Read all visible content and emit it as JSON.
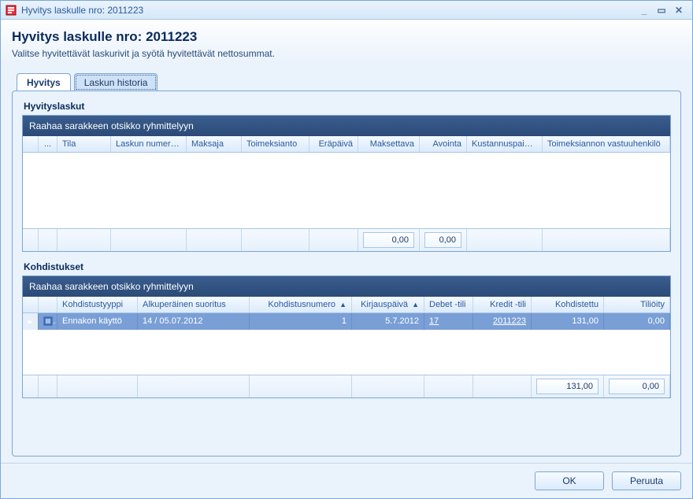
{
  "window": {
    "title": "Hyvitys laskulle nro: 2011223"
  },
  "header": {
    "title": "Hyvitys laskulle nro: 2011223",
    "subtitle": "Valitse hyvitettävät laskurivit ja syötä hyvitettävät nettosummat."
  },
  "tabs": [
    {
      "label": "Hyvitys",
      "active": true
    },
    {
      "label": "Laskun historia",
      "active": false
    }
  ],
  "grid1": {
    "title": "Hyvityslaskut",
    "groupbar": "Raahaa sarakkeen otsikko ryhmittelyyn",
    "columns": {
      "expander": "...",
      "tila": "Tila",
      "laskun_numero": "Laskun numero",
      "sort_desc": "▼",
      "maksaja": "Maksaja",
      "toimeksianto": "Toimeksianto",
      "erapaiva": "Eräpäivä",
      "maksettava": "Maksettava",
      "avointa": "Avointa",
      "kustannuspaikka": "Kustannuspaikka",
      "toimeksiannon_vastuu": "Toimeksiannon vastuuhenkilö"
    },
    "sums": {
      "maksettava": "0,00",
      "avointa": "0,00"
    }
  },
  "grid2": {
    "title": "Kohdistukset",
    "groupbar": "Raahaa sarakkeen otsikko ryhmittelyyn",
    "columns": {
      "kohdistustyyppi": "Kohdistustyyppi",
      "alkuperainen_suoritus": "Alkuperäinen suoritus",
      "kohdistusnumero": "Kohdistusnumero",
      "sort_asc": "▲",
      "kirjauspaiva": "Kirjauspäivä",
      "debet_tili": "Debet -tili",
      "kredit_tili": "Kredit -tili",
      "kohdistettu": "Kohdistettu",
      "tilioity": "Tiliöity"
    },
    "rows": [
      {
        "indicator": "▸",
        "kohdistustyyppi": "Ennakon käyttö",
        "alkuperainen_suoritus": "14 / 05.07.2012",
        "kohdistusnumero": "1",
        "kirjauspaiva": "5.7.2012",
        "debet_tili": "17",
        "kredit_tili": "2011223",
        "kohdistettu": "131,00",
        "tilioity": "0,00"
      }
    ],
    "sums": {
      "kohdistettu": "131,00",
      "tilioity": "0,00"
    }
  },
  "buttons": {
    "ok": "OK",
    "cancel": "Peruuta"
  },
  "winbuttons": {
    "min": "_",
    "max": "▭",
    "close": "✕"
  }
}
